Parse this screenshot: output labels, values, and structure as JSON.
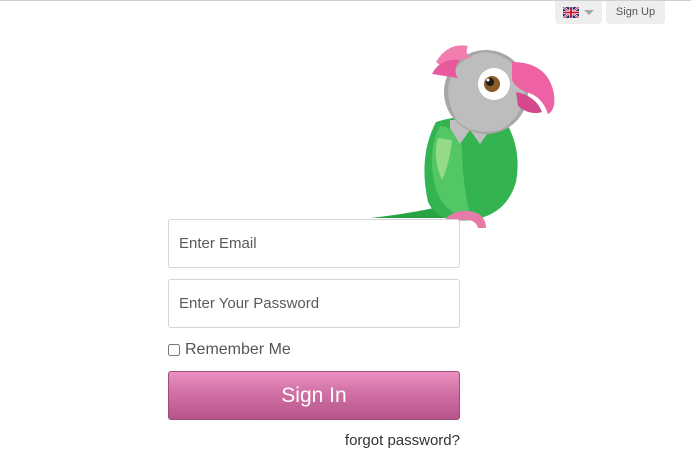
{
  "header": {
    "language_icon": "uk-flag-icon",
    "language_dropdown_icon": "caret-down-icon",
    "signup_label": "Sign Up"
  },
  "mascot": {
    "icon": "parrot-mascot",
    "colors": {
      "body": "#2fb34a",
      "head": "#bfbfbf",
      "beak": "#e8589c",
      "crest": "#f06fa6"
    }
  },
  "login_form": {
    "email_placeholder": "Enter Email",
    "password_placeholder": "Enter Your Password",
    "remember_label": "Remember Me",
    "remember_checked": false,
    "signin_label": "Sign In",
    "forgot_label": "forgot password?"
  },
  "colors": {
    "accent": "#d070a4",
    "header_button_bg": "#eeeeee"
  }
}
